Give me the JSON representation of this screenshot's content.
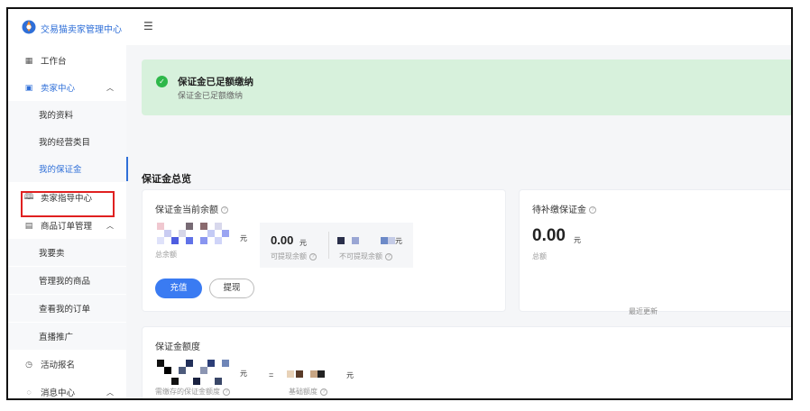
{
  "app": {
    "title": "交易猫卖家管理中心",
    "menu_toggle_icon": "menu-fold-icon"
  },
  "sidebar": {
    "items": [
      {
        "label": "工作台",
        "icon": "grid-icon"
      },
      {
        "label": "卖家中心",
        "icon": "store-icon",
        "expanded": true
      },
      {
        "label": "我的资料"
      },
      {
        "label": "我的经营类目"
      },
      {
        "label": "我的保证金",
        "selected": true
      },
      {
        "label": "卖家指导中心",
        "icon": "book-icon"
      },
      {
        "label": "商品订单管理",
        "icon": "document-icon",
        "expanded": true
      },
      {
        "label": "我要卖"
      },
      {
        "label": "管理我的商品"
      },
      {
        "label": "查看我的订单"
      },
      {
        "label": "直播推广"
      },
      {
        "label": "活动报名",
        "icon": "clock-icon"
      },
      {
        "label": "消息中心",
        "icon": "message-icon",
        "expanded": true
      }
    ]
  },
  "banner": {
    "title": "保证金已足额缴纳",
    "subtitle": "保证金已足额缴纳",
    "status_color": "#2eb84a"
  },
  "overview": {
    "title": "保证金总览",
    "balance_card": {
      "title": "保证金当前余额",
      "total_unit": "元",
      "total_caption": "总余额",
      "withdrawable_amount": "0.00",
      "withdrawable_unit": "元",
      "withdrawable_caption": "可提现余额",
      "non_withdrawable_unit": "元",
      "non_withdrawable_caption": "不可提现余额",
      "recharge_button": "充值",
      "withdraw_button": "提现"
    },
    "due_card": {
      "title": "待补缴保证金",
      "amount": "0.00",
      "unit": "元",
      "caption": "总额"
    },
    "quota_card": {
      "title": "保证金额度",
      "right_link": "最近更新",
      "equals": "=",
      "unit_left": "元",
      "unit_right": "元",
      "caption_left": "需缴存的保证金额度",
      "caption_right": "基础额度"
    }
  },
  "colors": {
    "accent": "#2f6fd8",
    "primary_button": "#3a7bf2",
    "highlight_box": "#e02020",
    "banner_bg": "#d7f1dc"
  }
}
